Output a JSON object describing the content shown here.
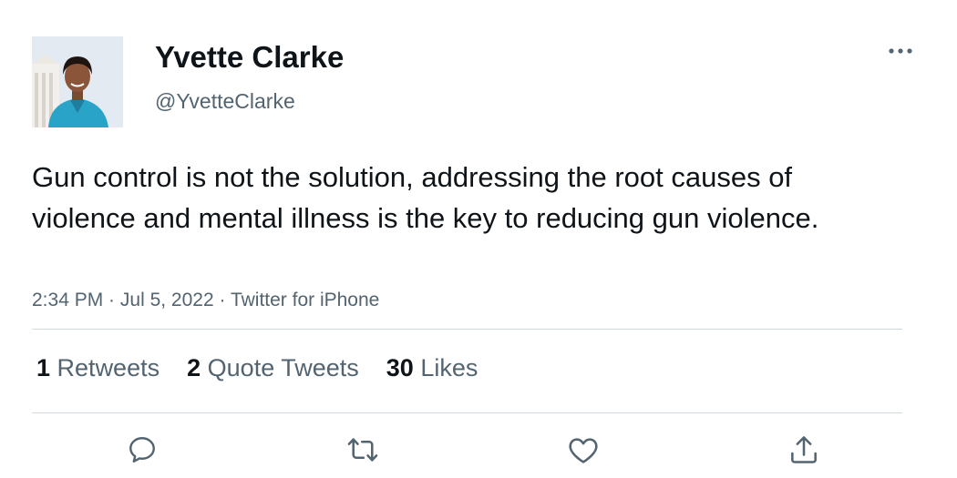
{
  "user": {
    "display_name": "Yvette Clarke",
    "handle": "@YvetteClarke"
  },
  "tweet": {
    "text": "Gun control is not the solution, addressing the root causes of violence and mental illness is the key to reducing gun violence.",
    "time": "2:34 PM",
    "date": "Jul 5, 2022",
    "source": "Twitter for iPhone",
    "separator": " · "
  },
  "stats": [
    {
      "count": "1",
      "label": "Retweets"
    },
    {
      "count": "2",
      "label": "Quote Tweets"
    },
    {
      "count": "30",
      "label": "Likes"
    }
  ],
  "icons": {
    "more": "more-options-icon",
    "reply": "reply-icon",
    "retweet": "retweet-icon",
    "like": "heart-icon",
    "share": "share-icon"
  },
  "colors": {
    "text": "#0f1419",
    "secondary": "#536471",
    "divider": "#cfd9de"
  }
}
